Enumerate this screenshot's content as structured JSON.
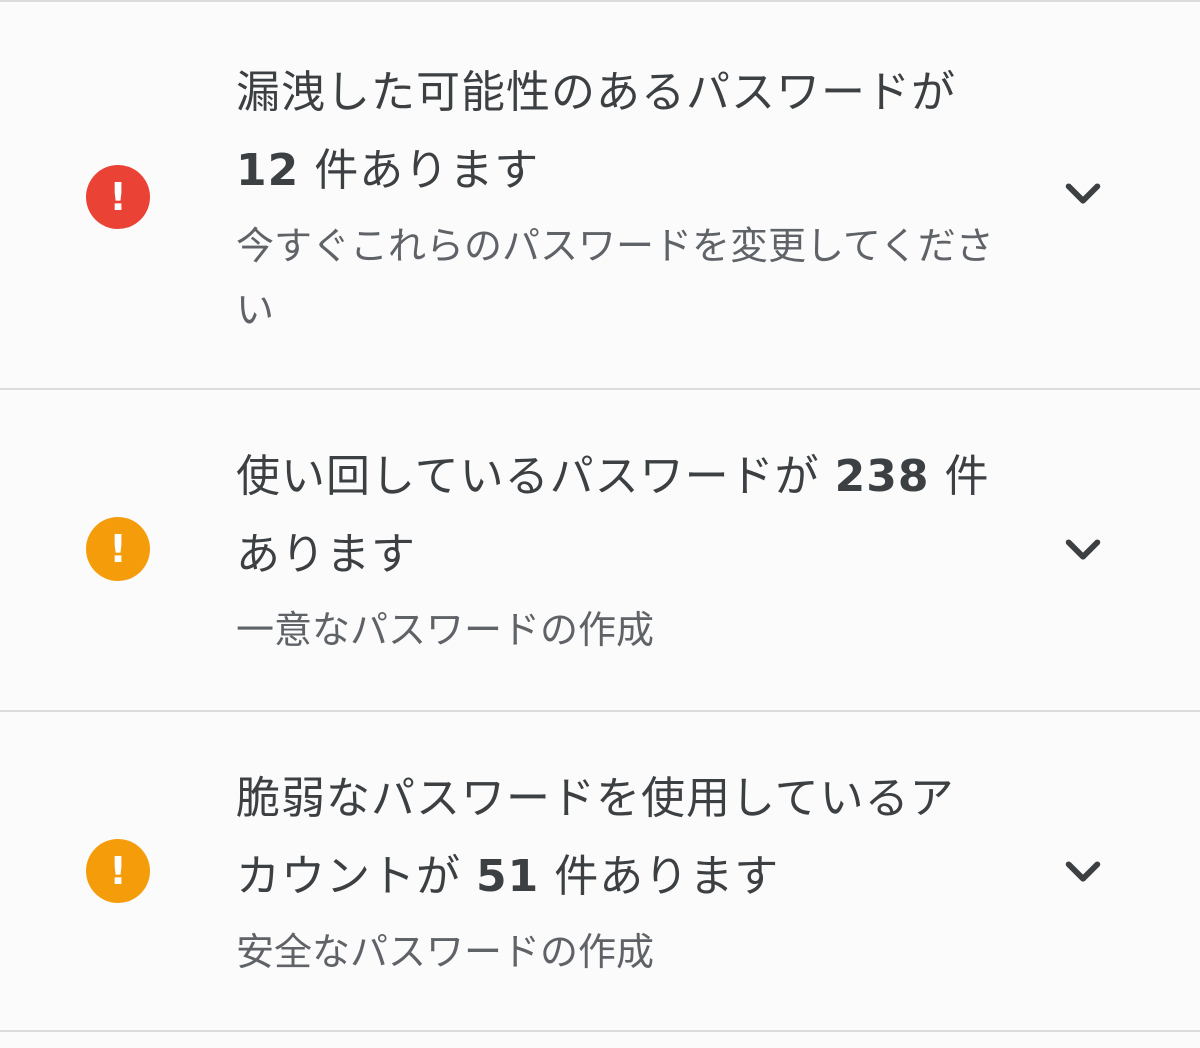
{
  "colors": {
    "error": "#ea4335",
    "warning": "#f59c0a",
    "divider": "#dcdcdc",
    "chevron": "#3c4043"
  },
  "items": [
    {
      "status_icon": "error-icon",
      "status_glyph": "!",
      "title_pre": "漏洩した可能性のあるパスワードが ",
      "title_num": "12",
      "title_post": " 件あります",
      "description": "今すぐこれらのパスワードを変更してください",
      "chevron_icon": "chevron-down-icon"
    },
    {
      "status_icon": "warning-icon",
      "status_glyph": "!",
      "title_pre": "使い回しているパスワードが ",
      "title_num": "238",
      "title_post": " 件あります",
      "description": "一意なパスワードの作成",
      "chevron_icon": "chevron-down-icon"
    },
    {
      "status_icon": "warning-icon",
      "status_glyph": "!",
      "title_pre": "脆弱なパスワードを使用しているアカウントが ",
      "title_num": "51",
      "title_post": " 件あります",
      "description": "安全なパスワードの作成",
      "chevron_icon": "chevron-down-icon"
    }
  ]
}
